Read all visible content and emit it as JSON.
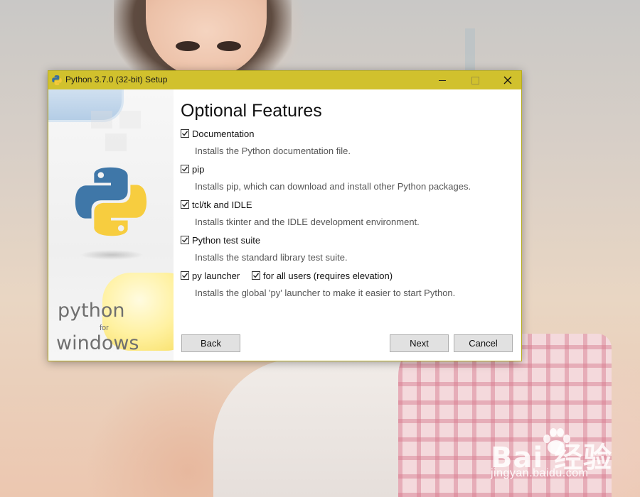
{
  "window": {
    "title": "Python 3.7.0 (32-bit) Setup",
    "accent_color": "#d1c12d",
    "controls": {
      "minimize_icon": "minimize-icon",
      "maximize_icon": "maximize-icon",
      "close_icon": "close-icon"
    }
  },
  "banner": {
    "logo_icon": "python-logo-icon",
    "brand_line1": "python",
    "brand_line2": "for",
    "brand_line3": "windows"
  },
  "page": {
    "title": "Optional Features",
    "features": [
      {
        "label": "Documentation",
        "checked": true,
        "description": "Installs the Python documentation file."
      },
      {
        "label": "pip",
        "checked": true,
        "description": "Installs pip, which can download and install other Python packages."
      },
      {
        "label": "tcl/tk and IDLE",
        "checked": true,
        "description": "Installs tkinter and the IDLE development environment."
      },
      {
        "label": "Python test suite",
        "checked": true,
        "description": "Installs the standard library test suite."
      },
      {
        "label": "py launcher",
        "checked": true,
        "description": "Installs the global 'py' launcher to make it easier to start Python.",
        "sub_option": {
          "label": "for all users (requires elevation)",
          "checked": true
        }
      }
    ]
  },
  "buttons": {
    "back": "Back",
    "next": "Next",
    "cancel": "Cancel"
  },
  "watermark": {
    "logo": "Bai  经验",
    "sub": "jingyan.baidu.com",
    "paw_icon": "baidu-paw-icon"
  }
}
